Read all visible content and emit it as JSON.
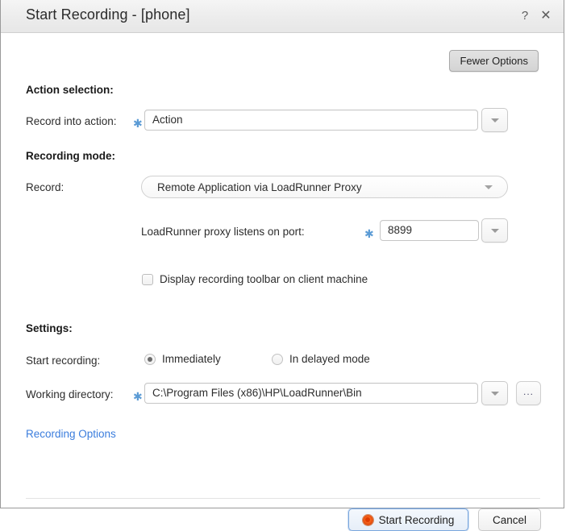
{
  "window": {
    "title": "Start Recording - [phone]",
    "help_icon": "question-mark-icon",
    "close_icon": "close-icon"
  },
  "toolbar": {
    "fewer_options_label": "Fewer Options"
  },
  "sections": {
    "action_selection": {
      "heading": "Action selection:",
      "record_into_action": {
        "label": "Record into action:",
        "required_marker": "✱",
        "value": "Action"
      }
    },
    "recording_mode": {
      "heading": "Recording mode:",
      "record": {
        "label": "Record:",
        "value": "Remote Application via LoadRunner Proxy"
      },
      "proxy_port": {
        "label": "LoadRunner proxy listens on port:",
        "required_marker": "✱",
        "value": "8899"
      },
      "display_toolbar": {
        "label": "Display recording toolbar on client machine",
        "checked": false
      }
    },
    "settings": {
      "heading": "Settings:",
      "start_recording": {
        "label": "Start recording:",
        "options": [
          {
            "label": "Immediately",
            "selected": true
          },
          {
            "label": "In delayed mode",
            "selected": false
          }
        ]
      },
      "working_directory": {
        "label": "Working directory:",
        "required_marker": "✱",
        "value": "C:\\Program Files (x86)\\HP\\LoadRunner\\Bin",
        "browse_label": "..."
      }
    },
    "recording_options_link": "Recording Options"
  },
  "footer": {
    "primary_label": "Start Recording",
    "cancel_label": "Cancel",
    "record_icon": "record-dot-icon"
  },
  "colors": {
    "accent_blue": "#3b7ddd",
    "required_star": "#5b9bd5",
    "record_orange": "#f05a15",
    "titlebar": "#ececec"
  }
}
